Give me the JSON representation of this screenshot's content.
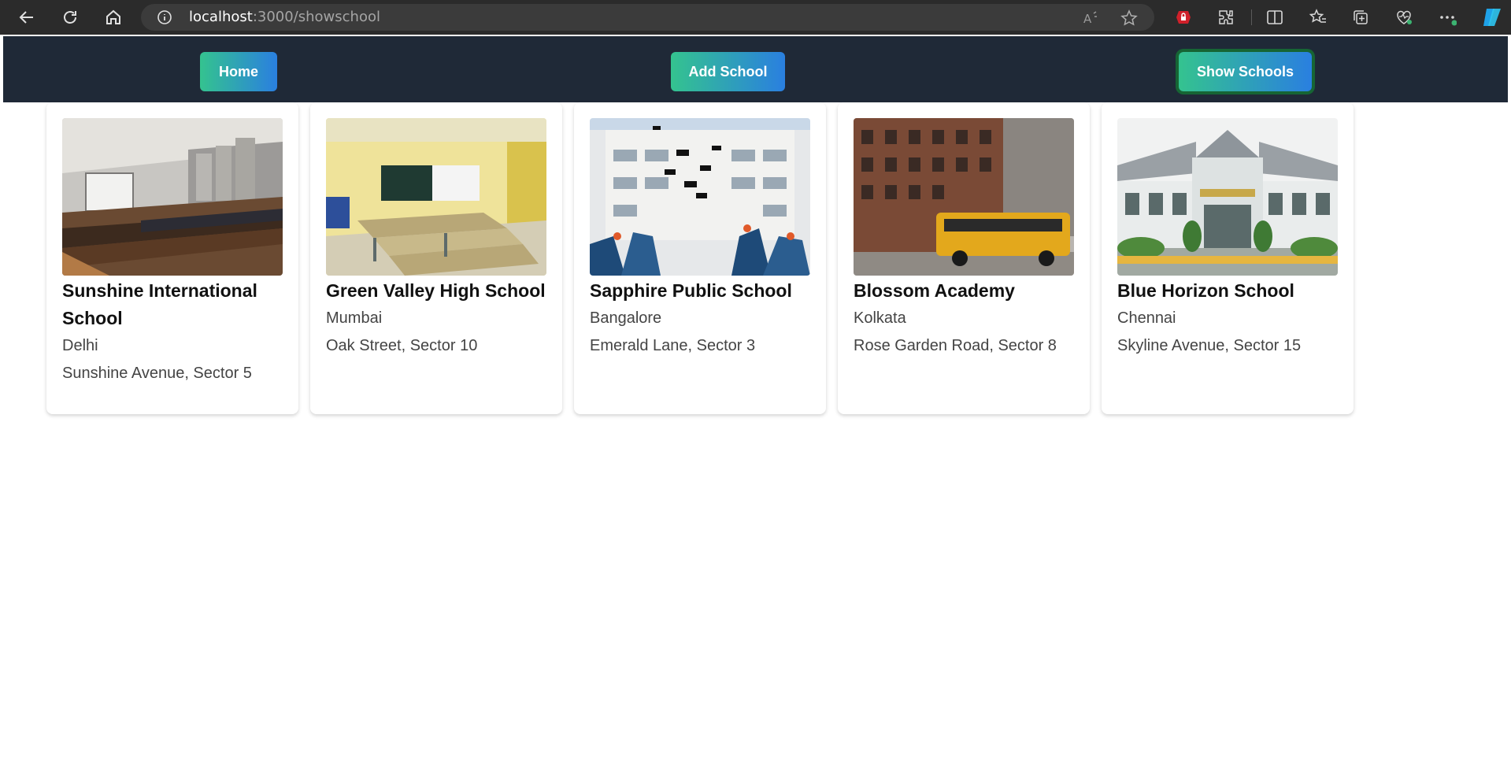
{
  "browser": {
    "url_host": "localhost",
    "url_path": ":3000/showschool"
  },
  "navbar": {
    "home_label": "Home",
    "add_label": "Add School",
    "show_label": "Show Schools"
  },
  "schools": [
    {
      "name": "Sunshine International School",
      "city": "Delhi",
      "address": "Sunshine Avenue, Sector 5",
      "image": "lecture-hall-photo"
    },
    {
      "name": "Green Valley High School",
      "city": "Mumbai",
      "address": "Oak Street, Sector 10",
      "image": "classroom-photo"
    },
    {
      "name": "Sapphire Public School",
      "city": "Bangalore",
      "address": "Emerald Lane, Sector 3",
      "image": "graduation-photo"
    },
    {
      "name": "Blossom Academy",
      "city": "Kolkata",
      "address": "Rose Garden Road, Sector 8",
      "image": "school-bus-photo"
    },
    {
      "name": "Blue Horizon School",
      "city": "Chennai",
      "address": "Skyline Avenue, Sector 15",
      "image": "school-building-photo"
    }
  ],
  "colors": {
    "navbar_bg": "#1f2937",
    "button_gradient_start": "#34c38f",
    "button_gradient_end": "#2a7fe0",
    "active_ring": "#166534"
  }
}
